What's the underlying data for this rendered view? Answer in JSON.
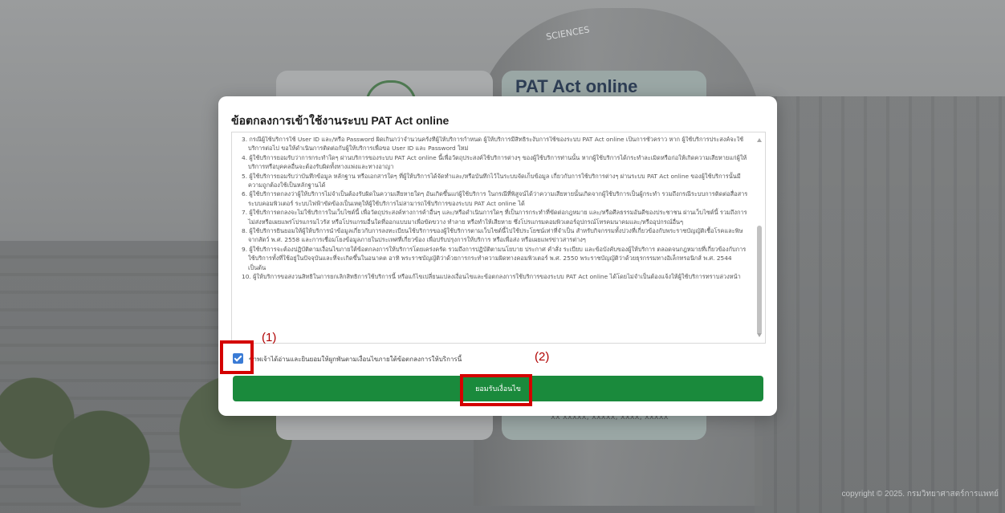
{
  "background": {
    "card_title": "PAT Act online",
    "banner_text": "SCIENCES",
    "footer_text": "xx xxxxx, xxxxx, xxxx, xxxxx",
    "copyright": "copyright © 2025. กรมวิทยาศาสตร์การแพทย์"
  },
  "modal": {
    "title": "ข้อตกลงการเข้าใช้งานระบบ PAT Act online",
    "terms": [
      "3. กรณีผู้ใช้บริการใช้ User ID และ/หรือ Password ผิดเกินกว่าจำนวนครั้งที่ผู้ให้บริการกำหนด ผู้ให้บริการมีสิทธิระงับการใช้ของระบบ PAT Act online เป็นการชั่วคราว หาก ผู้ใช้บริการประสงค์จะใช้บริการต่อไป ขอให้ดำเนินการติดต่อกับผู้ให้บริการเพื่อขอ User ID และ Password ใหม่",
      "4. ผู้ใช้บริการยอมรับว่าการกระทำใดๆ ผ่านบริการของระบบ PAT Act online นี้เพื่อวัตถุประสงค์ใช้บริการต่างๆ ของผู้ใช้บริการท่านนั้น หากผู้ใช้บริการได้กระทำละเมิดหรือก่อให้เกิดความเสียหายแก่ผู้ให้บริการหรือบุคคลอื่นจะต้องรับผิดทั้งทางแพ่งและทางอาญา",
      "5. ผู้ใช้บริการยอมรับว่าบันทึกข้อมูล หลักฐาน หรือเอกสารใดๆ ที่ผู้ให้บริการได้จัดทำและ/หรือบันทึกไว้ในระบบจัดเก็บข้อมูล เกี่ยวกับการใช้บริการต่างๆ ผ่านระบบ PAT Act online ของผู้ใช้บริการนั้นมีความถูกต้องใช้เป็นหลักฐานได้",
      "6. ผู้ใช้บริการตกลงว่าผู้ให้บริการไม่จำเป็นต้องรับผิดในความเสียหายใดๆ อันเกิดขึ้นแก่ผู้ใช้บริการ ในกรณีที่พิสูจน์ได้ว่าความเสียหายนั้นเกิดจากผู้ใช้บริการเป็นผู้กระทำ รวมถึงกรณีระบบการติดต่อสื่อสาร ระบบคอมพิวเตอร์ ระบบไฟฟ้าขัดข้องเป็นเหตุให้ผู้ใช้บริการไม่สามารถใช้บริการของระบบ PAT Act online ได้",
      "7. ผู้ใช้บริการตกลงจะไม่ใช้บริการในเว็บไซต์นี้ เพื่อวัตถุประสงค์ทางการค้าอื่นๆ และ/หรือดำเนินการใดๆ ที่เป็นการกระทำที่ขัดต่อกฎหมาย และ/หรือศีลธรรมอันดีของประชาชน ผ่านเว็บไซต์นี้ รวมถึงการไม่ส่งหรือเผยแพร่โปรแกรมไวรัส หรือโปรแกรมอื่นใดที่ออกแบบมาเพื่อขัดขวาง ทำลาย หรือทำให้เสียหาย ซึ่งโปรแกรมคอมพิวเตอร์อุปกรณ์โทรคมนาคมและ/หรืออุปกรณ์อื่นๆ",
      "8. ผู้ใช้บริการยินยอมให้ผู้ให้บริการนำข้อมูลเกี่ยวกับการลงทะเบียนใช้บริการของผู้ใช้บริการตามเว็บไซต์นี้ไปใช้ประโยชน์เท่าที่จำเป็น สำหรับกิจกรรมทั้งปวงที่เกี่ยวข้องกับพระราชบัญญัติเชื้อโรคและพิษจากสัตว์ พ.ศ. 2558 และการเชื่อมโยงข้อมูลภายในประเทศที่เกี่ยวข้อง เพื่อปรับปรุงการให้บริการ หรือเพื่อส่ง หรือเผยแพร่ข่าวสารต่างๆ",
      "9. ผู้ใช้บริการจะต้องปฏิบัติตามเงื่อนไขภายใต้ข้อตกลงการให้บริการโดยเคร่งครัด รวมถึงการปฏิบัติตามนโยบาย ประกาศ คำสั่ง ระเบียบ และข้อบังคับของผู้ให้บริการ ตลอดจนกฎหมายที่เกี่ยวข้องกับการใช้บริการทั้งที่ใช้อยู่ในปัจจุบันและที่จะเกิดขึ้นในอนาคต อาทิ พระราชบัญญัติว่าด้วยการกระทำความผิดทางคอมพิวเตอร์ พ.ศ. 2550 พระราชบัญญัติว่าด้วยธุรกรรมทางอิเล็กทรอนิกส์ พ.ศ. 2544 เป็นต้น",
      "10. ผู้ให้บริการขอสงวนสิทธิในการยกเลิกสิทธิการใช้บริการนี้ หรือแก้ไขเปลี่ยนแปลงเงื่อนไขและข้อตกลงการใช้บริการของระบบ PAT Act online ได้โดยไม่จำเป็นต้องแจ้งให้ผู้ใช้บริการทราบล่วงหน้า"
    ],
    "agree_checked": true,
    "agree_label": "ข้าพเจ้าได้อ่านและยินยอมให้ผูกพันตามเงื่อนไขภายใต้ข้อตกลงการให้บริการนี้",
    "accept_button": "ยอมรับเงื่อนไข"
  },
  "annotations": {
    "label_1": "(1)",
    "label_2": "(2)",
    "color": "#d40000"
  }
}
